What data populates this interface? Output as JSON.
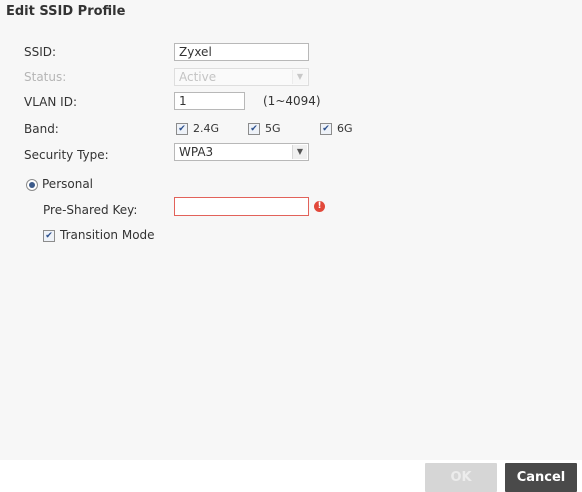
{
  "dialog": {
    "title": "Edit SSID Profile"
  },
  "form": {
    "ssid": {
      "label": "SSID:",
      "value": "Zyxel"
    },
    "status": {
      "label": "Status:",
      "value": "Active",
      "disabled": true
    },
    "vlan": {
      "label": "VLAN ID:",
      "value": "1",
      "range": "(1~4094)"
    },
    "band": {
      "label": "Band:",
      "options": [
        {
          "label": "2.4G",
          "checked": true
        },
        {
          "label": "5G",
          "checked": true
        },
        {
          "label": "6G",
          "checked": true
        }
      ]
    },
    "security_type": {
      "label": "Security Type:",
      "value": "WPA3"
    },
    "personal": {
      "label": "Personal",
      "selected": true
    },
    "pre_shared_key": {
      "label": "Pre-Shared Key:",
      "value": "",
      "error": true
    },
    "transition_mode": {
      "label": "Transition Mode",
      "checked": true
    }
  },
  "footer": {
    "ok_label": "OK",
    "cancel_label": "Cancel"
  },
  "icons": {
    "checkmark": "check-icon",
    "dropdown": "chevron-down-icon",
    "error": "exclamation-icon"
  },
  "colors": {
    "error": "#e2483a",
    "cancel_bg": "#4a4a4a",
    "ok_bg_disabled": "#d6d6d6"
  }
}
